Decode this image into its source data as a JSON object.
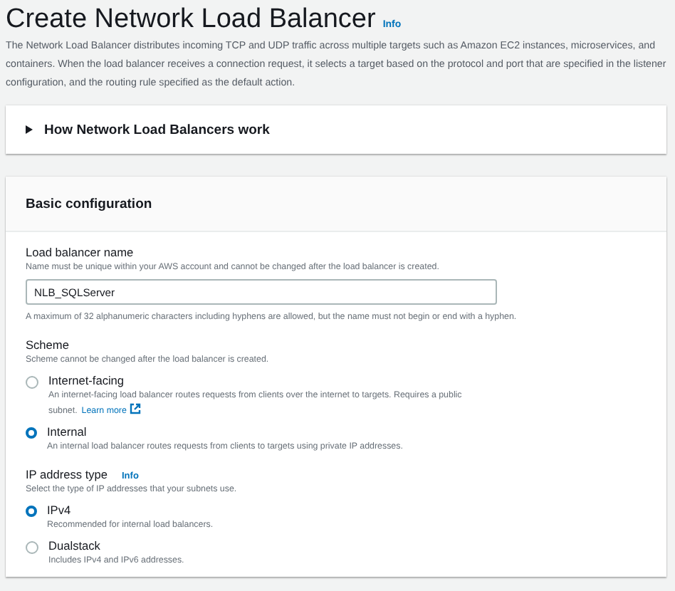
{
  "title": "Create Network Load Balancer",
  "title_info": "Info",
  "description": "The Network Load Balancer distributes incoming TCP and UDP traffic across multiple targets such as Amazon EC2 instances, microservices, and containers. When the load balancer receives a connection request, it selects a target based on the protocol and port that are specified in the listener configuration, and the routing rule specified as the default action.",
  "expander": {
    "label": "How Network Load Balancers work",
    "expanded": false
  },
  "section": {
    "title": "Basic configuration",
    "name_field": {
      "label": "Load balancer name",
      "hint": "Name must be unique within your AWS account and cannot be changed after the load balancer is created.",
      "value": "NLB_SQLServer",
      "constraint": "A maximum of 32 alphanumeric characters including hyphens are allowed, but the name must not begin or end with a hyphen."
    },
    "scheme": {
      "label": "Scheme",
      "hint": "Scheme cannot be changed after the load balancer is created.",
      "options": [
        {
          "label": "Internet-facing",
          "description": "An internet-facing load balancer routes requests from clients over the internet to targets. Requires a public subnet.",
          "link": "Learn more",
          "selected": false
        },
        {
          "label": "Internal",
          "description": "An internal load balancer routes requests from clients to targets using private IP addresses.",
          "selected": true
        }
      ]
    },
    "ip_type": {
      "label": "IP address type",
      "info": "Info",
      "hint": "Select the type of IP addresses that your subnets use.",
      "options": [
        {
          "label": "IPv4",
          "description": "Recommended for internal load balancers.",
          "selected": true
        },
        {
          "label": "Dualstack",
          "description": "Includes IPv4 and IPv6 addresses.",
          "selected": false
        }
      ]
    }
  }
}
